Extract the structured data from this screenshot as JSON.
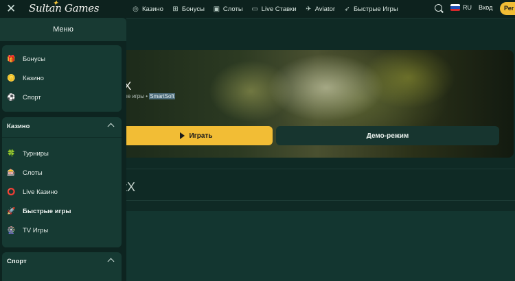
{
  "topbar": {
    "logo": "Sultan Games",
    "nav": [
      {
        "label": "Казино",
        "icon": "casino-chip-icon"
      },
      {
        "label": "Бонусы",
        "icon": "gift-icon"
      },
      {
        "label": "Слоты",
        "icon": "slots-icon"
      },
      {
        "label": "Live Ставки",
        "icon": "live-bets-icon"
      },
      {
        "label": "Aviator",
        "icon": "plane-icon"
      },
      {
        "label": "Быстрые Игры",
        "icon": "rocket-icon"
      }
    ],
    "lang": "RU",
    "login_label": "Вход",
    "register_label": "Рег"
  },
  "game": {
    "title": "X",
    "category_fragment": "ые игры • ",
    "provider": "SmartSoft",
    "play_label": "Играть",
    "demo_label": "Демо-режим",
    "name_fragment": "tX"
  },
  "sidebar": {
    "title": "Меню",
    "main_items": [
      {
        "label": "Бонусы",
        "icon": "gift-icon"
      },
      {
        "label": "Казино",
        "icon": "casino-chip-icon"
      },
      {
        "label": "Спорт",
        "icon": "football-icon"
      }
    ],
    "casino_section": {
      "title": "Казино",
      "items": [
        {
          "label": "Турниры",
          "icon": "clover-icon"
        },
        {
          "label": "Слоты",
          "icon": "slot-machine-icon"
        },
        {
          "label": "Live Казино",
          "icon": "roulette-icon"
        },
        {
          "label": "Быстрые игры",
          "icon": "rocket-icon"
        },
        {
          "label": "TV Игры",
          "icon": "tv-wheel-icon"
        }
      ]
    },
    "sport_section": {
      "title": "Спорт"
    }
  },
  "colors": {
    "accent": "#f2bd35",
    "background": "#0f2a25",
    "panel": "#163a33"
  }
}
